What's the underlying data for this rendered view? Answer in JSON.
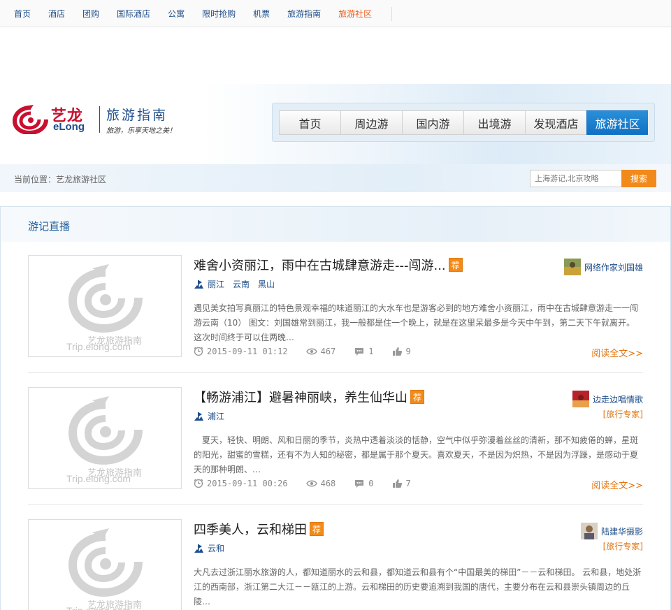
{
  "topnav": {
    "items": [
      {
        "label": "首页"
      },
      {
        "label": "酒店"
      },
      {
        "label": "团购"
      },
      {
        "label": "国际酒店"
      },
      {
        "label": "公寓"
      },
      {
        "label": "限时抢购"
      },
      {
        "label": "机票"
      },
      {
        "label": "旅游指南"
      },
      {
        "label": "旅游社区",
        "active": true
      }
    ]
  },
  "logo": {
    "brand_cn": "艺龙",
    "brand_en": "eLong",
    "guide": "旅游指南",
    "slogan": "旅游，乐享天地之美！"
  },
  "mainnav": {
    "items": [
      {
        "label": "首页"
      },
      {
        "label": "周边游"
      },
      {
        "label": "国内游"
      },
      {
        "label": "出境游"
      },
      {
        "label": "发现酒店"
      },
      {
        "label": "旅游社区",
        "active": true
      }
    ]
  },
  "breadcrumb": {
    "text": "当前位置：艺龙旅游社区"
  },
  "search": {
    "placeholder": "上海游记,北京攻略",
    "button": "搜索"
  },
  "section": {
    "title": "游记直播"
  },
  "watermark": {
    "line1": "艺龙旅游指南",
    "line2": "Trip.elong.com"
  },
  "entries": [
    {
      "title": "难舍小资丽江，雨中在古城肆意游走---闯游...",
      "rec": "荐",
      "tags": [
        "丽江",
        "云南",
        "黑山"
      ],
      "summary": "遇见美女拍写真丽江的特色景观幸福的味道丽江的大水车也是游客必到的地方难舍小资丽江，雨中在古城肆意游走一一闯游云南（10） 图文：刘国雄常到丽江，我一般都是住一个晚上，就是在这里呆最多是今天中午到，第二天下午就离开。这次时间终于可以住两晚…",
      "time": "2015-09-11 01:12",
      "views": "467",
      "comments": "1",
      "likes": "9",
      "more": "阅读全文>>",
      "author": "网络作家刘国雄",
      "badge": ""
    },
    {
      "title": "【畅游浦江】避暑神丽峡，养生仙华山",
      "rec": "荐",
      "tags": [
        "浦江"
      ],
      "summary": "　夏天，轻快、明朗、风和日丽的季节，炎热中透着淡淡的恬静，空气中似乎弥漫着丝丝的清新，那不知疲倦的蝉，星斑的阳光，甜蜜的雪糕，还有不为人知的秘密，都是属于那个夏天。喜欢夏天，不是因为炽热，不是因为浮躁，是感动于夏天的那种明朗、…",
      "time": "2015-09-11 00:26",
      "views": "468",
      "comments": "0",
      "likes": "7",
      "more": "阅读全文>>",
      "author": "边走边唱情歌",
      "badge": "[旅行专家]"
    },
    {
      "title": "四季美人，云和梯田",
      "rec": "荐",
      "tags": [
        "云和"
      ],
      "summary": "大凡去过浙江丽水旅游的人，都知道丽水的云和县，都知道云和县有个“中国最美的梯田”－－云和梯田。 云和县，地处浙江的西南部，浙江第二大江－－瓯江的上游。云和梯田的历史要追溯到我国的唐代，主要分布在云和县崇头镇周边的丘陵…",
      "time": "",
      "views": "",
      "comments": "",
      "likes": "",
      "more": "",
      "author": "陆建华摄影",
      "badge": "[旅行专家]"
    }
  ]
}
